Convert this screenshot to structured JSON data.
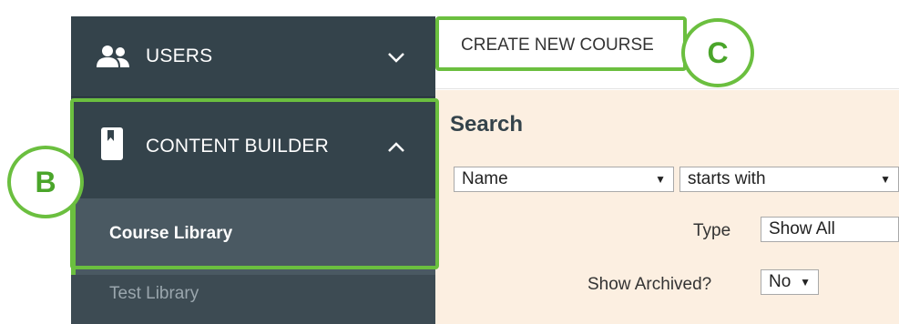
{
  "sidebar": {
    "users": {
      "label": "USERS",
      "icon": "users-icon"
    },
    "content_builder": {
      "label": "CONTENT BUILDER",
      "icon": "book-icon"
    },
    "sub_items": [
      {
        "label": "Course Library",
        "active": true
      },
      {
        "label": "Test Library",
        "active": false
      }
    ]
  },
  "toolbar": {
    "create_label": "CREATE NEW COURSE"
  },
  "search": {
    "title": "Search",
    "field_select": "Name",
    "operator_select": "starts with",
    "type_label": "Type",
    "type_select": "Show All",
    "archived_label": "Show Archived?",
    "archived_select": "No"
  },
  "callouts": {
    "b": "B",
    "c": "C"
  },
  "colors": {
    "sidebar_bg": "#34434b",
    "sidebar_active": "#4a5962",
    "accent_green": "#6bbf3f",
    "panel_bg": "#fcefe1"
  }
}
